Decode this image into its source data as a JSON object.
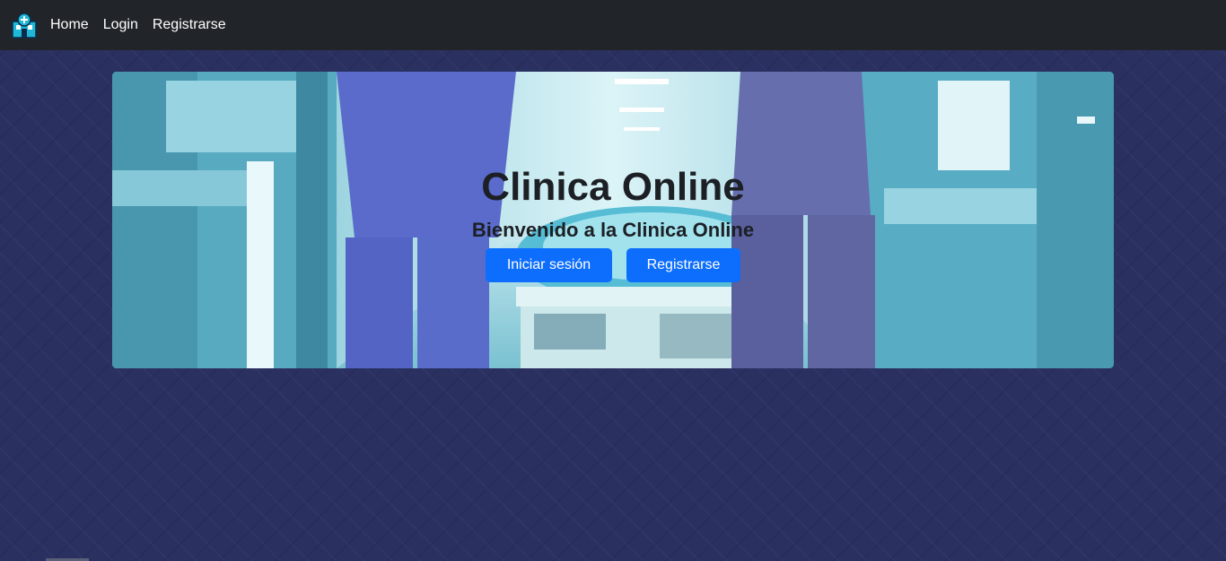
{
  "navbar": {
    "brand_icon": "hospital-icon",
    "links": [
      {
        "label": "Home"
      },
      {
        "label": "Login"
      },
      {
        "label": "Registrarse"
      }
    ]
  },
  "hero": {
    "background": "hospital-corridor-photo",
    "title": "Clinica Online",
    "subtitle": "Bienvenido a la Clinica Online",
    "buttons": {
      "login": "Iniciar sesión",
      "register": "Registrarse"
    }
  },
  "colors": {
    "navbar_bg": "#212529",
    "page_bg": "#2a3060",
    "button_primary": "#0d6efd"
  }
}
